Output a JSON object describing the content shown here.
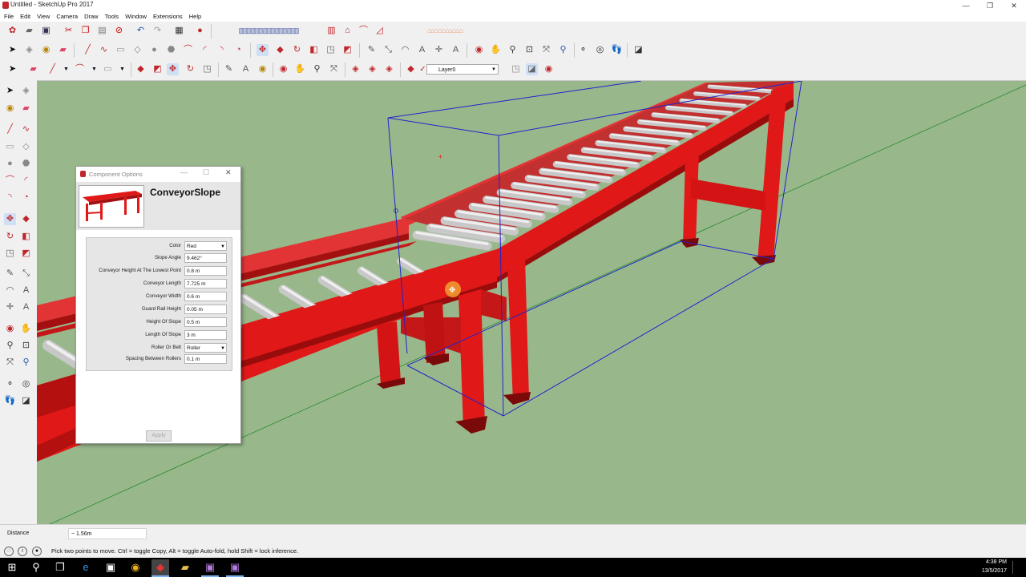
{
  "window": {
    "title": "Untitled - SketchUp Pro 2017",
    "minimize": "—",
    "maximize": "❐",
    "close": "✕"
  },
  "menu": [
    "File",
    "Edit",
    "View",
    "Camera",
    "Draw",
    "Tools",
    "Window",
    "Extensions",
    "Help"
  ],
  "toolbar": {
    "layer_name": "Layer0"
  },
  "dialog": {
    "title": "Component Options",
    "component_name": "ConveyorSlope",
    "fields": [
      {
        "label": "Color",
        "value": "Red"
      },
      {
        "label": "Slope Angle",
        "value": "9.462°"
      },
      {
        "label": "Conveyor Height At The Lowest Point",
        "value": "0.8 m"
      },
      {
        "label": "Conveyor Length",
        "value": "7.725 m"
      },
      {
        "label": "Conveyor Width",
        "value": "0.6 m"
      },
      {
        "label": "Guard Rail Height",
        "value": "0.05 m"
      },
      {
        "label": "Height Of Slope",
        "value": "0.5 m"
      },
      {
        "label": "Length Of Slope",
        "value": "3 m"
      },
      {
        "label": "Roller Or Belt",
        "value": "Roller"
      },
      {
        "label": "Spacing Between Rollers",
        "value": "0.1 m"
      }
    ],
    "apply_label": "Apply"
  },
  "status": {
    "measure_label": "Distance",
    "measure_value": "~ 1.56m",
    "hint": "Pick two points to move.  Ctrl = toggle Copy, Alt = toggle Auto-fold, hold Shift = lock inference."
  },
  "taskbar": {
    "time": "4:38 PM",
    "date": "13/5/2017"
  },
  "colors": {
    "conveyor": "#e01818",
    "ground": "#98b88c",
    "bounding_box": "#2222cc",
    "roller": "#c8c8c8"
  }
}
